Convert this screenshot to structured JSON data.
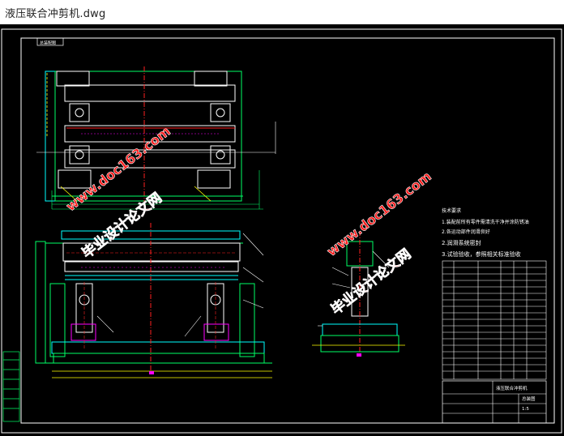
{
  "window": {
    "title": "液压联合冲剪机.dwg"
  },
  "colors": {
    "background": "#000000",
    "frame": "#ffffff",
    "outline": "#00ff66",
    "hidden": "#00ffff",
    "centerline": "#ff2020",
    "dimension": "#ffff00",
    "detail": "#ff00ff",
    "watermark": "#ff1a1a"
  },
  "drawing": {
    "small_tag": "总装配图",
    "notes": {
      "heading": "技术要求",
      "line1": "1.装配前所有零件需清洗干净并涂防锈油",
      "line2": "2.各运动部件润滑良好",
      "line3": "2.润滑系统密封",
      "line4": "3.试验验收，参照相关标准验收"
    },
    "title_block": {
      "drawing_name": "液压联合冲剪机",
      "scale": "1:5",
      "sheet": "总装图"
    }
  },
  "watermarks": [
    {
      "main": "毕业设计论文网",
      "url": "www.doc163.com"
    },
    {
      "main": "毕业设计论文网",
      "url": "www.doc163.com"
    }
  ]
}
